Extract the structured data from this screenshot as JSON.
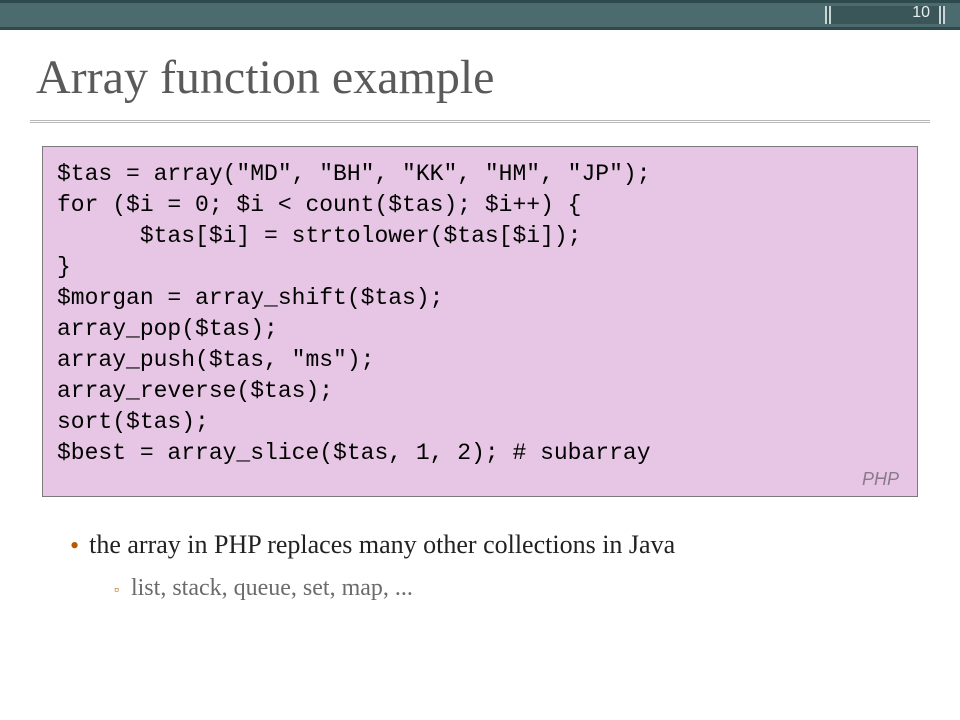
{
  "page_number": "10",
  "title": "Array function example",
  "code_block": {
    "language_label": "PHP",
    "lines": [
      "$tas = array(\"MD\", \"BH\", \"KK\", \"HM\", \"JP\");",
      "for ($i = 0; $i < count($tas); $i++) {",
      "      $tas[$i] = strtolower($tas[$i]);",
      "}",
      "$morgan = array_shift($tas);",
      "array_pop($tas);",
      "array_push($tas, \"ms\");",
      "array_reverse($tas);",
      "sort($tas);",
      "$best = array_slice($tas, 1, 2); # subarray"
    ]
  },
  "bullets": {
    "level1": "the array in PHP replaces many other collections in Java",
    "level2": "list, stack, queue, set, map, ..."
  }
}
